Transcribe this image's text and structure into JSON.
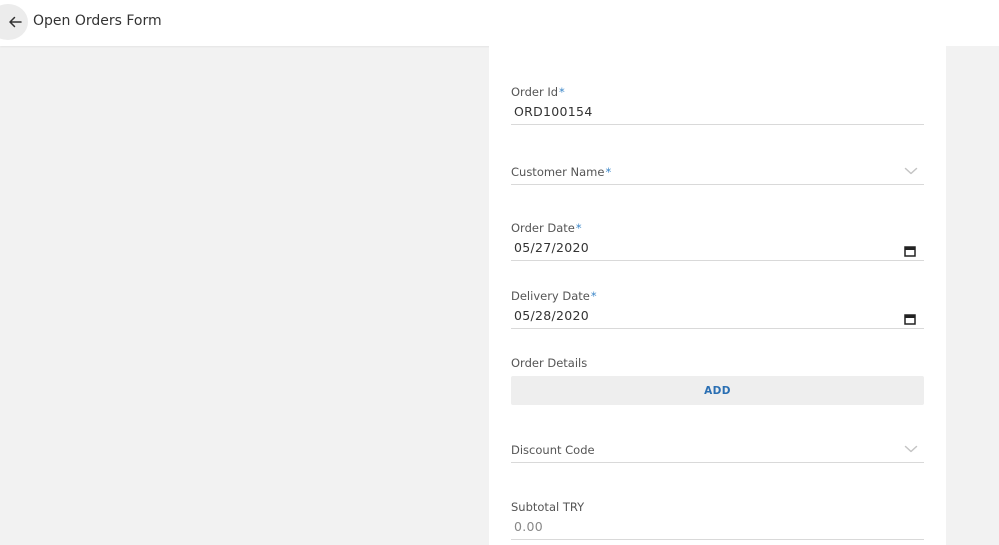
{
  "header": {
    "title": "Open Orders Form",
    "back_icon": "arrow-left-icon"
  },
  "form": {
    "order_id": {
      "label": "Order Id",
      "required_mark": "*",
      "value": "ORD100154"
    },
    "customer_name": {
      "label": "Customer Name",
      "required_mark": "*",
      "value": "",
      "icon": "chevron-down-icon"
    },
    "order_date": {
      "label": "Order Date",
      "required_mark": "*",
      "value": "05/27/2020",
      "icon": "calendar-icon"
    },
    "delivery_date": {
      "label": "Delivery Date",
      "required_mark": "*",
      "value": "05/28/2020",
      "icon": "calendar-icon"
    },
    "order_details": {
      "label": "Order Details",
      "add_label": "ADD"
    },
    "discount_code": {
      "label": "Discount Code",
      "value": "",
      "icon": "chevron-down-icon"
    },
    "subtotal": {
      "label": "Subtotal TRY",
      "value": "0.00"
    }
  },
  "colors": {
    "required": "#3b86c8",
    "accent": "#2a6fb3",
    "background": "#f2f2f2"
  }
}
